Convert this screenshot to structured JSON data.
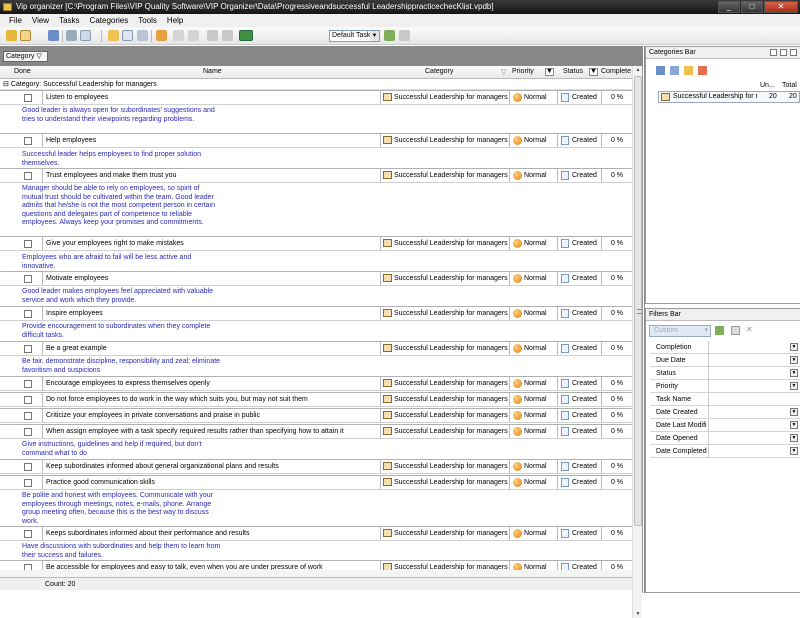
{
  "window": {
    "title": "Vip organizer [C:\\Program Files\\VIP Quality Software\\VIP Organizer\\Data\\Progressiveandsuccessful LeadershippracticechecKlist.vpdb]",
    "min": "_",
    "max": "□",
    "close": "✕"
  },
  "menu": [
    "File",
    "View",
    "Tasks",
    "Categories",
    "Tools",
    "Help"
  ],
  "toolbar": {
    "task_view_value": "Default Task"
  },
  "grid": {
    "group_chip": "Category",
    "columns": {
      "done": "Done",
      "name": "Name",
      "category": "Category",
      "priority": "Priority",
      "status": "Status",
      "complete": "Complete"
    },
    "group_label": "Category: Successful Leadership for managers",
    "rows": [
      {
        "name": "Listen to employees",
        "note": "Good leader is always open for subordinates' suggestions and tries to understand their viewpoints regarding problems."
      },
      {
        "name": "Help employees",
        "note": "Successful leader helps employees to find proper solution themselves."
      },
      {
        "name": "Trust employees and make them trust you",
        "note": "Manager should be able to rely on employees, so spirit of mutual trust should be cultivated within the team. Good leader admits that he/she is not the most competent person in certain questions and delegates part of competence to reliable employees. Always keep your promises and commitments."
      },
      {
        "name": "Give your employees right to make mistakes",
        "note": "Employees who are afraid to fail will be less active and innovative."
      },
      {
        "name": "Motivate employees",
        "note": "Good leader makes employees feel appreciated with valuable service and work which they provide."
      },
      {
        "name": "Inspire employees",
        "note": "Provide encouragement to subordinates when they complete difficult tasks."
      },
      {
        "name": "Be a great example",
        "note": "Be fair, demonstrate discipline, responsibility and zeal; eliminate favoritism and suspicions"
      },
      {
        "name": "Encourage employees to express themselves openly",
        "note": ""
      },
      {
        "name": "Do not force employees to do work in the way which suits you, but may not suit them",
        "note": ""
      },
      {
        "name": "Criticize your employees in private conversations and praise in public",
        "note": ""
      },
      {
        "name": "When assign employee with a task specify required results rather than specifying how to attain it",
        "note": "Give instructions, guidelines and help if required, but don't command what to do"
      },
      {
        "name": "Keep subordinates informed about general organizational plans and results",
        "note": ""
      },
      {
        "name": "Practice good communication skills",
        "note": "Be polite and honest with employees. Communicate with your employees through meetings, notes, e-mails, phone. Arrange group meeting often, because this is the best way to discuss work."
      },
      {
        "name": "Keeps subordinates informed about their performance and results",
        "note": "Have discussions with subordinates and help them to learn from their success and failures."
      },
      {
        "name": "Be accessible for employees and easy to talk, even when you are under pressure of work",
        "note": ""
      }
    ],
    "row_category": "Successful Leadership for managers",
    "row_priority": "Normal",
    "row_status": "Created",
    "row_complete": "0 %",
    "count": "Count: 20"
  },
  "categories_bar": {
    "title": "Categories Bar",
    "col_uncompleted": "Un...",
    "col_total": "Total",
    "item_label": "Successful Leadership for m",
    "item_uncompleted": "20",
    "item_total": "20"
  },
  "filters_bar": {
    "title": "Filters Bar",
    "custom_label": "Custom",
    "fields": [
      "Completion",
      "Due Date",
      "Status",
      "Priority",
      "Task Name",
      "Date Created",
      "Date Last Modifi",
      "Date Opened",
      "Date Completed"
    ]
  }
}
